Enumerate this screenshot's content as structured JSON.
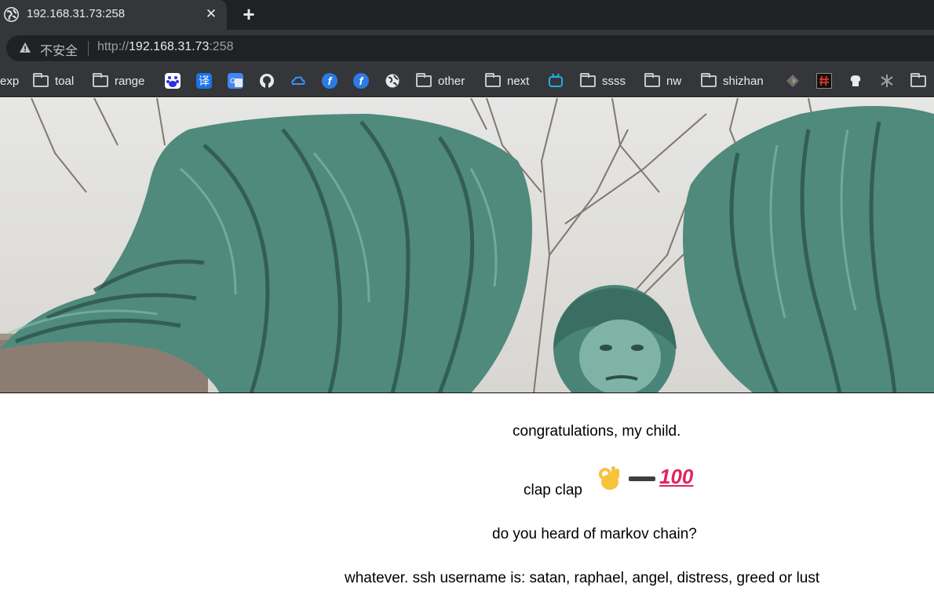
{
  "browser": {
    "tab": {
      "title": "192.168.31.73:258",
      "close_glyph": "✕"
    },
    "new_tab_glyph": "+",
    "omnibox": {
      "security_label": "不安全",
      "url_scheme": "http://",
      "url_host": "192.168.31.73",
      "url_port": ":258"
    },
    "bookmarks": [
      {
        "type": "text",
        "label": "exp"
      },
      {
        "type": "folder",
        "label": "toal"
      },
      {
        "type": "folder",
        "label": "range"
      },
      {
        "type": "icon",
        "icon": "baidu-icon"
      },
      {
        "type": "icon",
        "icon": "translate-icon"
      },
      {
        "type": "icon",
        "icon": "google-translate-icon"
      },
      {
        "type": "icon",
        "icon": "github-icon"
      },
      {
        "type": "icon",
        "icon": "cloud-icon"
      },
      {
        "type": "icon",
        "icon": "fofa-icon"
      },
      {
        "type": "icon",
        "icon": "fofa-icon"
      },
      {
        "type": "icon",
        "icon": "globe-icon"
      },
      {
        "type": "folder",
        "label": "other"
      },
      {
        "type": "folder",
        "label": "next"
      },
      {
        "type": "icon",
        "icon": "bilibili-icon"
      },
      {
        "type": "folder",
        "label": "ssss"
      },
      {
        "type": "folder",
        "label": "nw"
      },
      {
        "type": "folder",
        "label": "shizhan"
      },
      {
        "type": "icon",
        "icon": "site-icon-1"
      },
      {
        "type": "icon",
        "icon": "site-icon-2"
      },
      {
        "type": "icon",
        "icon": "site-icon-3"
      },
      {
        "type": "icon",
        "icon": "site-icon-4"
      },
      {
        "type": "folder",
        "label": ""
      }
    ]
  },
  "page": {
    "line1": "congratulations, my child.",
    "line2": "clap clap",
    "line2_emoji": "👌➖💯",
    "line3": "do you heard of markov chain?",
    "line4": "whatever. ssh username is: satan, raphael, angel, distress, greed or lust"
  },
  "colors": {
    "tab_strip": "#202124",
    "toolbar": "#35363a",
    "statue_patina": "#4f8a7c",
    "hundred_red": "#e0245e"
  }
}
